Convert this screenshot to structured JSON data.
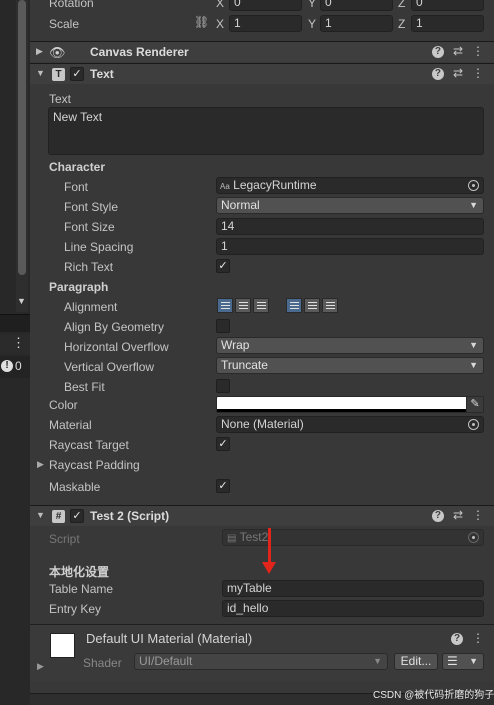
{
  "transform": {
    "rotation_label": "Rotation",
    "scale_label": "Scale",
    "rotation": {
      "x_label": "X",
      "x": "0",
      "y_label": "Y",
      "y": "0",
      "z_label": "Z",
      "z": "0"
    },
    "scale": {
      "x_label": "X",
      "x": "1",
      "y_label": "Y",
      "y": "1",
      "z_label": "Z",
      "z": "1"
    }
  },
  "left_panel": {
    "count": "0",
    "kebab": "⋮",
    "warn": "!"
  },
  "canvas_renderer": {
    "title": "Canvas Renderer"
  },
  "text_component": {
    "title": "Text",
    "text_label": "Text",
    "text_value": "New Text",
    "character_section": "Character",
    "font_label": "Font",
    "font_value": "LegacyRuntime",
    "font_style_label": "Font Style",
    "font_style_value": "Normal",
    "font_size_label": "Font Size",
    "font_size_value": "14",
    "line_spacing_label": "Line Spacing",
    "line_spacing_value": "1",
    "rich_text_label": "Rich Text",
    "paragraph_section": "Paragraph",
    "alignment_label": "Alignment",
    "align_by_geometry_label": "Align By Geometry",
    "h_overflow_label": "Horizontal Overflow",
    "h_overflow_value": "Wrap",
    "v_overflow_label": "Vertical Overflow",
    "v_overflow_value": "Truncate",
    "best_fit_label": "Best Fit",
    "color_label": "Color",
    "material_label": "Material",
    "material_value": "None (Material)",
    "raycast_target_label": "Raycast Target",
    "raycast_padding_label": "Raycast Padding",
    "maskable_label": "Maskable"
  },
  "script_component": {
    "title": "Test 2 (Script)",
    "script_label": "Script",
    "script_value": "Test2",
    "section_title": "本地化设置",
    "table_name_label": "Table Name",
    "table_name_value": "myTable",
    "entry_key_label": "Entry Key",
    "entry_key_value": "id_hello"
  },
  "material_component": {
    "title": "Default UI Material (Material)",
    "shader_label": "Shader",
    "shader_value": "UI/Default",
    "edit_label": "Edit...",
    "list_icon": "☰"
  },
  "watermark": "CSDN @被代码折磨的狗子",
  "icons": {
    "check": "✓",
    "help": "?",
    "settings": "⇄",
    "more": "⋮",
    "dropdown": "▼",
    "fold_open": "▼",
    "fold_closed": "▶",
    "eyedropper": "✎"
  }
}
